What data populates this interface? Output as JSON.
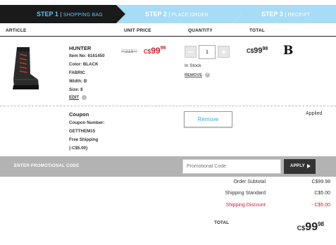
{
  "steps": [
    {
      "label": "STEP 1",
      "sub": "SHOPPING BAG"
    },
    {
      "label": "STEP 2",
      "sub": "PLACE ORDER"
    },
    {
      "label": "STEP 3",
      "sub": "RECEIPT"
    }
  ],
  "colors": {
    "step_active": "#1a1a1a",
    "step_inactive": "#a6dcf5",
    "accent_red": "#cc1f2e",
    "accent_blue": "#3aa6e6"
  },
  "columns": {
    "article": "ARTICLE",
    "unit_price": "UNIT PRICE",
    "quantity": "QUANTITY",
    "total": "TOTAL"
  },
  "product": {
    "name": "HUNTER",
    "item_no": "Item No: 6161450",
    "color": "Color: BLACK",
    "fabric": "FABRIC",
    "width": "Width: B",
    "size": "Size: 8",
    "edit": "EDIT",
    "old_price": "C$215.00",
    "old_price_display": "°°215°°",
    "price_cur": "C$",
    "price_main": "99",
    "price_cents": "98",
    "quantity": "1",
    "stock": "In Stock",
    "remove": "REMOVE",
    "total_cur": "C$",
    "total_main": "99",
    "total_cents": "98",
    "brand_logo": "B"
  },
  "coupon": {
    "title": "Coupon",
    "number_label": "Coupon Number:",
    "code": "GETTHEM15",
    "desc": "Free Shipping",
    "amount": "(-C$5.00)",
    "remove_button": "Remove",
    "status": "Applied"
  },
  "promo": {
    "label": "ENTER PROMOTIONAL CODE",
    "placeholder": "Promotional Code",
    "apply": "APPLY"
  },
  "summary": {
    "subtotal_label": "Order Subtotal",
    "subtotal_value": "C$99.98",
    "shipping_label": "Shipping Standard",
    "shipping_value": "C$5.00",
    "discount_label": "Shipping Discount",
    "discount_value": "- C$5.00",
    "total_label": "TOTAL",
    "total_cur": "C$",
    "total_main": "99",
    "total_cents": "98"
  }
}
